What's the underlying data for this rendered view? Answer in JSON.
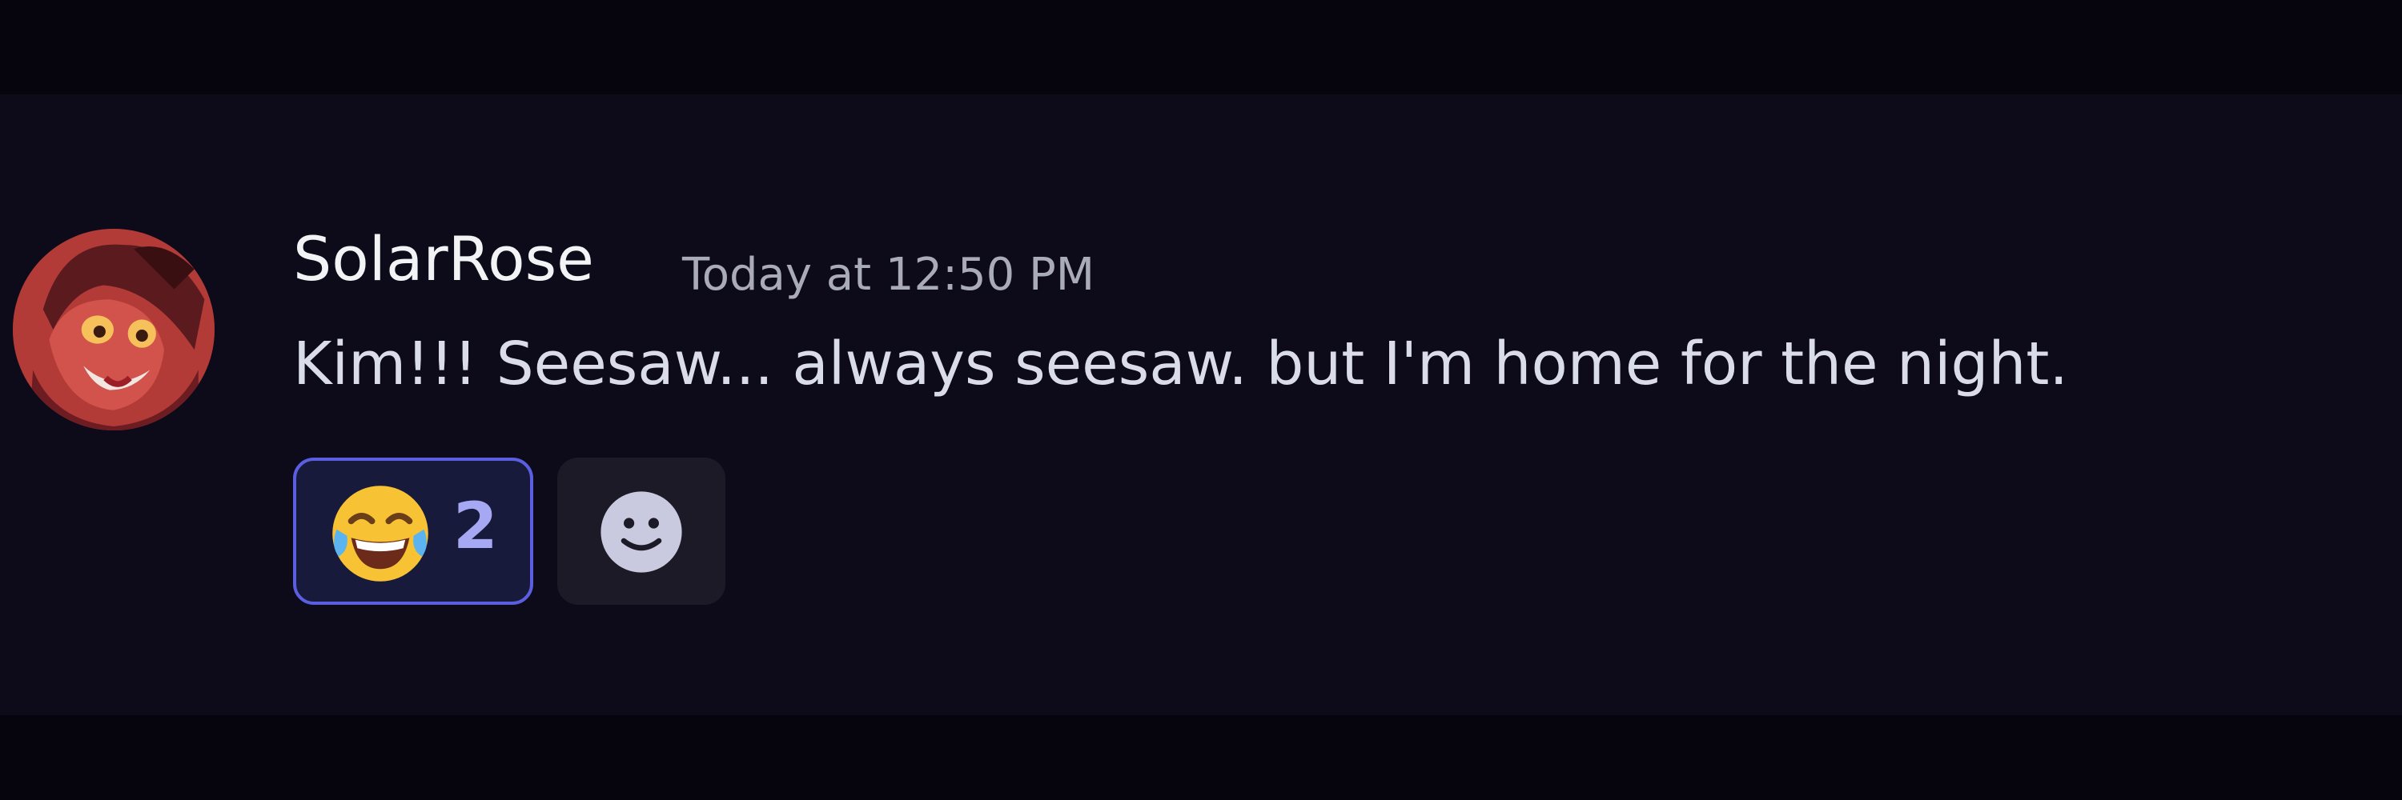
{
  "message": {
    "author": "SolarRose",
    "timestamp": "Today at 12:50 PM",
    "content": "Kim!!! Seesaw... always seesaw. but I'm home for the night."
  },
  "reactions": [
    {
      "emoji": "face-with-tears-of-joy",
      "count": "2",
      "reacted_by_me": true
    }
  ],
  "add_reaction_icon": "smile-icon",
  "colors": {
    "background": "#06050d",
    "message_background": "#0d0b1a",
    "accent": "#5b5ee0",
    "author": "#f2f3f5",
    "text": "#dbdcea",
    "muted": "#a9abb8"
  }
}
